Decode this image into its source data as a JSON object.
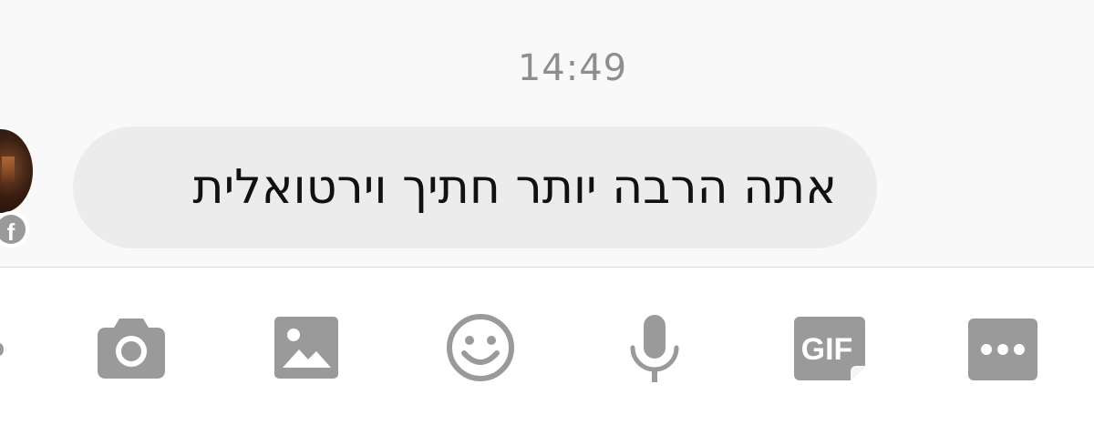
{
  "conversation": {
    "timestamp": "14:49",
    "message": "אתה הרבה יותר חתיך וירטואלית",
    "sender_badge": "f"
  },
  "toolbar": {
    "icons": [
      "camera-icon",
      "image-icon",
      "emoji-icon",
      "microphone-icon",
      "gif-icon",
      "more-icon"
    ],
    "gif_label": "GIF"
  },
  "colors": {
    "icon_gray": "#9a9a9a",
    "bubble_bg": "#ececec",
    "chat_bg": "#f9f9f9",
    "timestamp": "#8e8e8e"
  }
}
